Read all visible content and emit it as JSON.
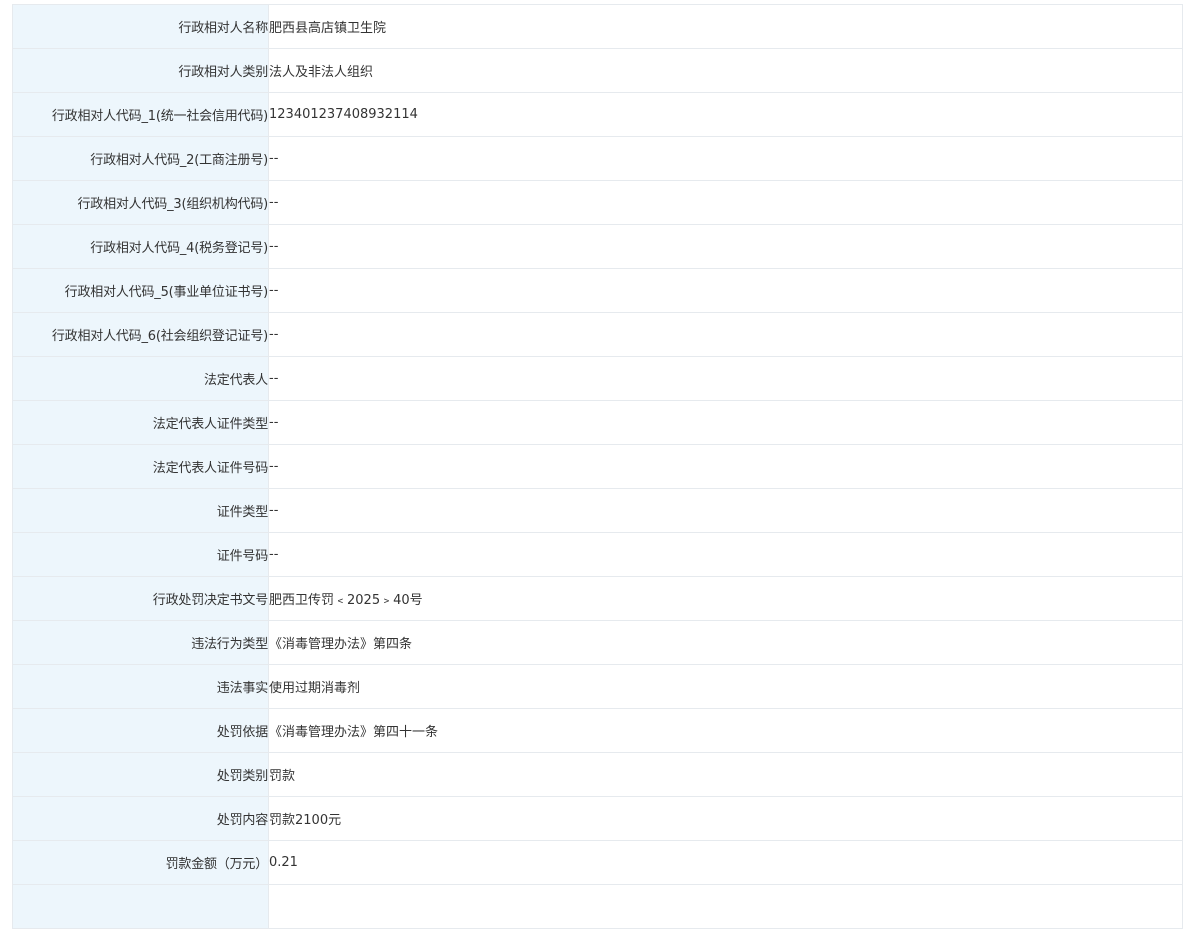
{
  "rows": [
    {
      "label": "行政相对人名称",
      "value": "肥西县高店镇卫生院"
    },
    {
      "label": "行政相对人类别",
      "value": "法人及非法人组织"
    },
    {
      "label": "行政相对人代码_1(统一社会信用代码)",
      "value": "12340123740893211​4"
    },
    {
      "label": "行政相对人代码_2(工商注册号)",
      "value": "--"
    },
    {
      "label": "行政相对人代码_3(组织机构代码)",
      "value": "--"
    },
    {
      "label": "行政相对人代码_4(税务登记号)",
      "value": "--"
    },
    {
      "label": "行政相对人代码_5(事业单位证书号)",
      "value": "--"
    },
    {
      "label": "行政相对人代码_6(社会组织登记证号)",
      "value": "--"
    },
    {
      "label": "法定代表人",
      "value": "--"
    },
    {
      "label": "法定代表人证件类型",
      "value": "--"
    },
    {
      "label": "法定代表人证件号码",
      "value": "--"
    },
    {
      "label": "证件类型",
      "value": "--"
    },
    {
      "label": "证件号码",
      "value": "--"
    },
    {
      "label": "行政处罚决定书文号",
      "value": "肥西卫传罚﹤2025﹥40号"
    },
    {
      "label": "违法行为类型",
      "value": "《消毒管理办法》第四条"
    },
    {
      "label": "违法事实",
      "value": "使用过期消毒剂"
    },
    {
      "label": "处罚依据",
      "value": "《消毒管理办法》第四十一条"
    },
    {
      "label": "处罚类别",
      "value": "罚款"
    },
    {
      "label": "处罚内容",
      "value": "罚款2100元"
    },
    {
      "label": "罚款金额（万元）",
      "value": "0.21"
    },
    {
      "label": "",
      "value": ""
    }
  ]
}
